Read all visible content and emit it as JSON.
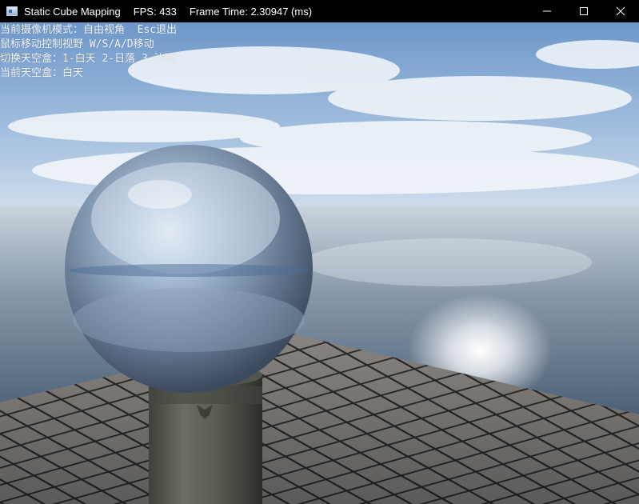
{
  "window": {
    "title": "Static Cube Mapping",
    "fps_label": "FPS: 433",
    "frame_time_label": "Frame Time: 2.30947 (ms)",
    "icons": {
      "minimize": "minimize-icon",
      "maximize": "maximize-icon",
      "close": "close-icon"
    }
  },
  "overlay": {
    "lines": [
      "当前摄像机模式：自由视角  Esc退出",
      "鼠标移动控制视野 W/S/A/D移动",
      "切换天空盒：1-白天 2-日落 3-沙漠",
      "当前天空盒：白天"
    ]
  }
}
